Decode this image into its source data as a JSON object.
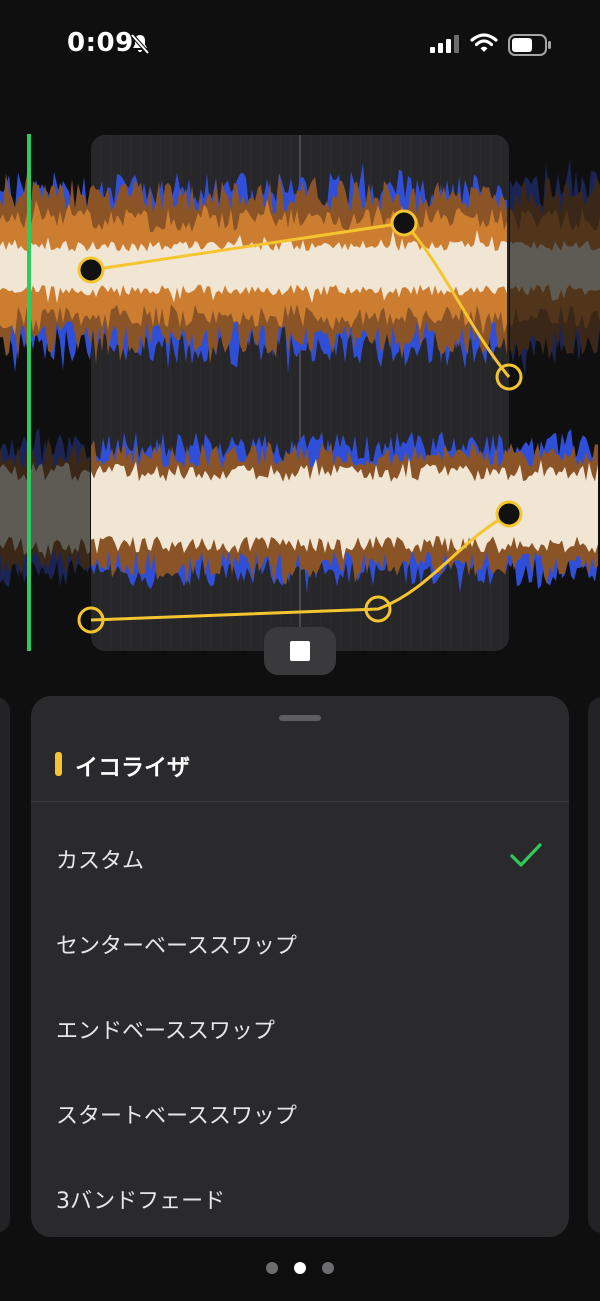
{
  "status_bar": {
    "time": "0:09"
  },
  "equalizer": {
    "title": "イコライザ",
    "options": [
      {
        "label": "カスタム",
        "selected": true
      },
      {
        "label": "センターベーススワップ",
        "selected": false
      },
      {
        "label": "エンドベーススワップ",
        "selected": false
      },
      {
        "label": "スタートベーススワップ",
        "selected": false
      },
      {
        "label": "3バンドフェード",
        "selected": false
      }
    ]
  },
  "pager": {
    "count": 3,
    "active_index": 1
  },
  "colors": {
    "accent": "#f5c52f",
    "playhead": "#2ecc5e",
    "checkmark": "#34c759",
    "wave_blue": "#2f4fd8",
    "wave_brown": "#8a5426",
    "wave_orange": "#cc7d30",
    "wave_cream": "#f1e6d4"
  }
}
